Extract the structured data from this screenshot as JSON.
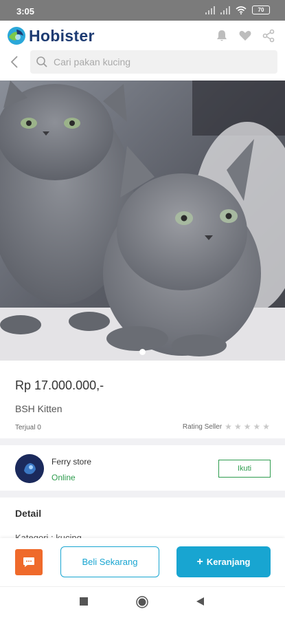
{
  "status_bar": {
    "time": "3:05",
    "battery": "70"
  },
  "header": {
    "brand_name": "Hobister",
    "search_placeholder": "Cari pakan kucing"
  },
  "product": {
    "price": "Rp 17.000.000,-",
    "title": "BSH Kitten",
    "sold": "Terjual 0",
    "rating_label": "Rating Seller",
    "rating_stars": 0
  },
  "seller": {
    "name": "Ferry store",
    "status": "Online",
    "follow_label": "Ikuti"
  },
  "detail": {
    "title": "Detail",
    "category": "Kategori : kucing"
  },
  "actions": {
    "buy_label": "Beli Sekarang",
    "cart_label": "Keranjang"
  },
  "colors": {
    "brand": "#1d3b72",
    "accent": "#18a5d1",
    "online": "#2e9c4e",
    "chat": "#ef6a2b"
  },
  "icons": [
    "bell-icon",
    "heart-icon",
    "share-icon",
    "back-arrow-icon",
    "search-icon",
    "chat-icon",
    "plus-icon"
  ]
}
